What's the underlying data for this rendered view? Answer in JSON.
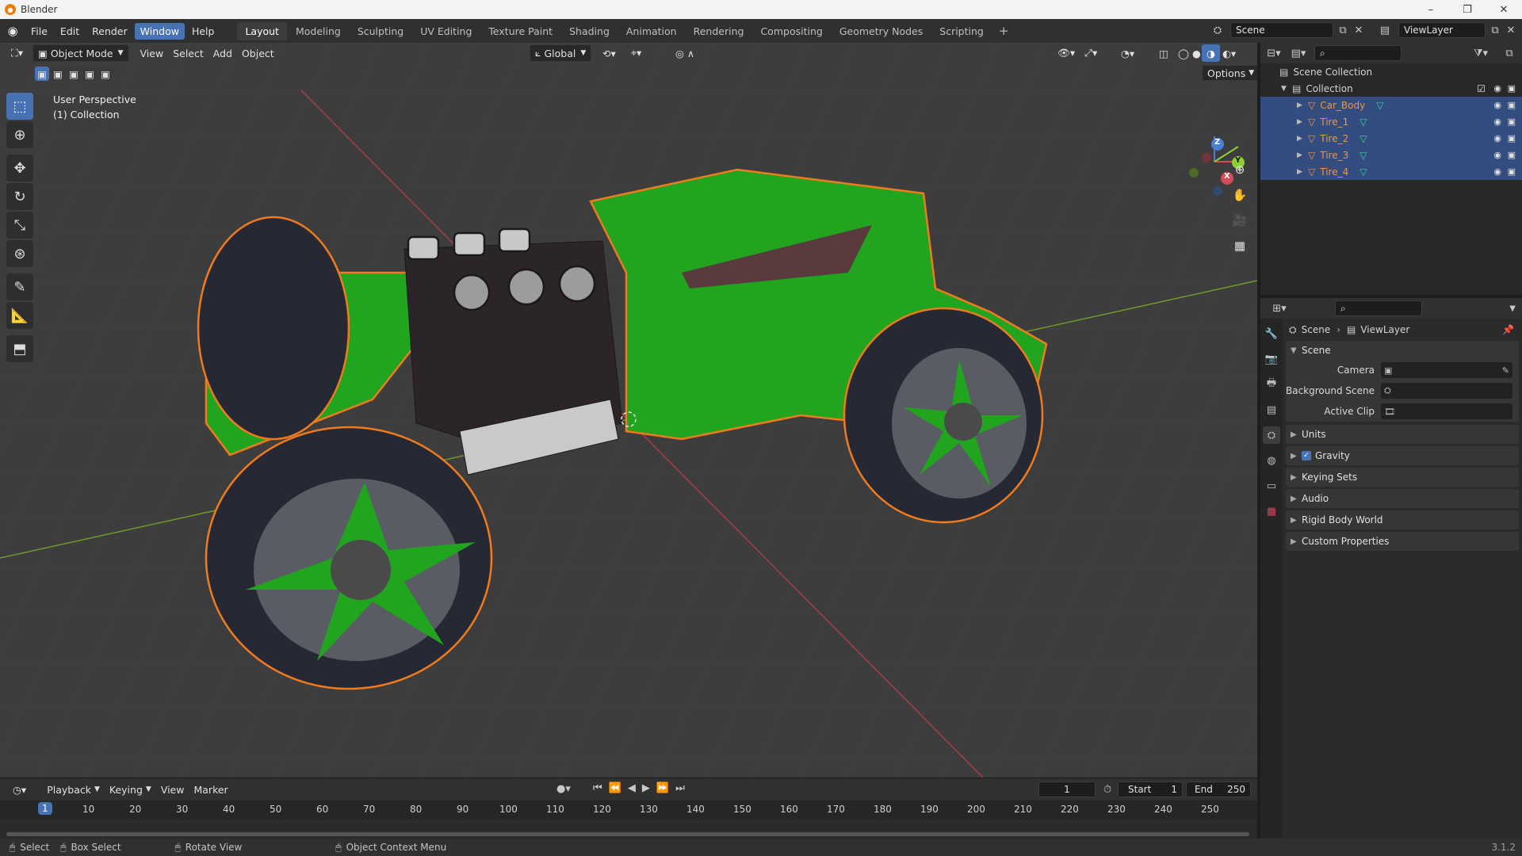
{
  "window": {
    "title": "Blender",
    "controls": [
      "–",
      "❐",
      "✕"
    ]
  },
  "menubar": {
    "items": [
      "File",
      "Edit",
      "Render",
      "Window",
      "Help"
    ],
    "active_item": "Window"
  },
  "workspaces": {
    "tabs": [
      "Layout",
      "Modeling",
      "Sculpting",
      "UV Editing",
      "Texture Paint",
      "Shading",
      "Animation",
      "Rendering",
      "Compositing",
      "Geometry Nodes",
      "Scripting"
    ],
    "active": "Layout",
    "add_label": "+"
  },
  "scene_selector": {
    "value": "Scene"
  },
  "viewlayer_selector": {
    "value": "ViewLayer"
  },
  "viewport": {
    "mode": "Object Mode",
    "menus": [
      "View",
      "Select",
      "Add",
      "Object"
    ],
    "orientation": "Global",
    "options_label": "Options",
    "info_line1": "User Perspective",
    "info_line2": "(1) Collection",
    "gizmo_axes": {
      "x": "X",
      "y": "Y",
      "z": "Z"
    }
  },
  "outliner": {
    "root": "Scene Collection",
    "collection": "Collection",
    "objects": [
      "Car_Body",
      "Tire_1",
      "Tire_2",
      "Tire_3",
      "Tire_4"
    ]
  },
  "properties": {
    "breadcrumb": {
      "scene": "Scene",
      "view_layer": "ViewLayer"
    },
    "scene_panel": {
      "title": "Scene",
      "rows": [
        {
          "label": "Camera",
          "value": ""
        },
        {
          "label": "Background Scene",
          "value": ""
        },
        {
          "label": "Active Clip",
          "value": ""
        }
      ]
    },
    "panels": [
      "Units",
      "Gravity",
      "Keying Sets",
      "Audio",
      "Rigid Body World",
      "Custom Properties"
    ],
    "gravity_checked": true
  },
  "timeline": {
    "menus": [
      "Playback",
      "Keying",
      "View",
      "Marker"
    ],
    "current_frame": "1",
    "start_label": "Start",
    "start": "1",
    "end_label": "End",
    "end": "250",
    "ruler": [
      "1",
      "10",
      "20",
      "30",
      "40",
      "50",
      "60",
      "70",
      "80",
      "90",
      "100",
      "110",
      "120",
      "130",
      "140",
      "150",
      "160",
      "170",
      "180",
      "190",
      "200",
      "210",
      "220",
      "230",
      "240",
      "250"
    ]
  },
  "statusbar": {
    "items": [
      "Select",
      "Box Select",
      "Rotate View",
      "Object Context Menu"
    ],
    "version": "3.1.2"
  },
  "colors": {
    "accent": "#4772b3",
    "selection_outline": "#f07b1e",
    "car_green": "#21a51f",
    "outliner_selected_row": "#334d80"
  }
}
